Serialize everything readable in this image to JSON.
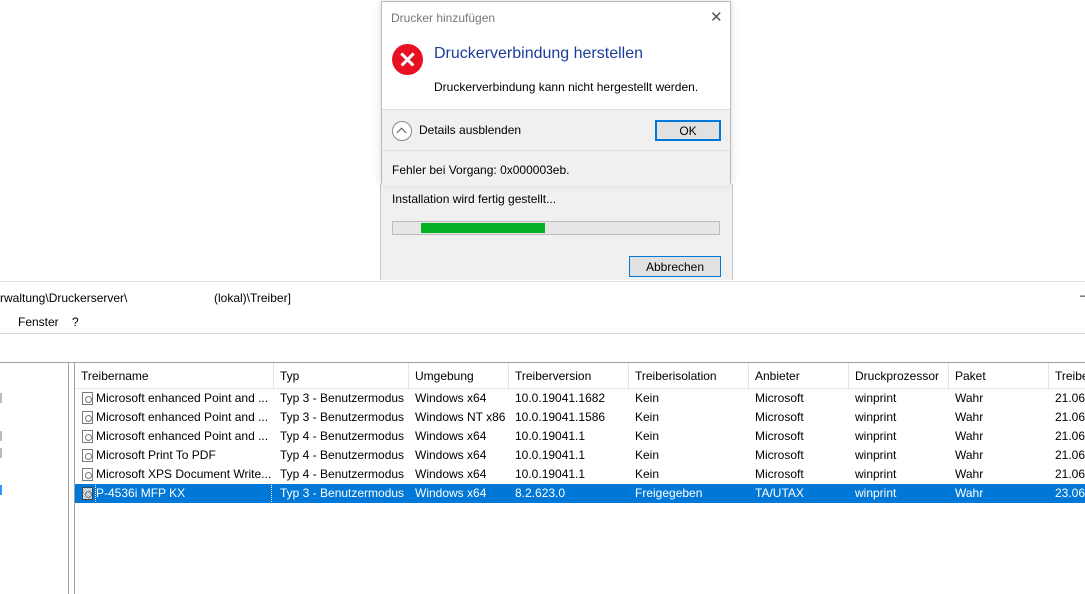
{
  "console": {
    "path_left": "rwaltung\\Druckerserver\\",
    "path_right": "(lokal)\\Treiber]",
    "minimize_glyph": "–",
    "menu": [
      "Fenster",
      "?"
    ]
  },
  "driver_table": {
    "columns": [
      "Treibername",
      "Typ",
      "Umgebung",
      "Treiberversion",
      "Treiberisolation",
      "Anbieter",
      "Druckprozessor",
      "Paket",
      "Treibe"
    ],
    "rows": [
      [
        "Microsoft enhanced Point and ...",
        "Typ 3 - Benutzermodus",
        "Windows x64",
        "10.0.19041.1682",
        "Kein",
        "Microsoft",
        "winprint",
        "Wahr",
        "21.06."
      ],
      [
        "Microsoft enhanced Point and ...",
        "Typ 3 - Benutzermodus",
        "Windows NT x86",
        "10.0.19041.1586",
        "Kein",
        "Microsoft",
        "winprint",
        "Wahr",
        "21.06."
      ],
      [
        "Microsoft enhanced Point and ...",
        "Typ 4 - Benutzermodus",
        "Windows x64",
        "10.0.19041.1",
        "Kein",
        "Microsoft",
        "winprint",
        "Wahr",
        "21.06."
      ],
      [
        "Microsoft Print To PDF",
        "Typ 4 - Benutzermodus",
        "Windows x64",
        "10.0.19041.1",
        "Kein",
        "Microsoft",
        "winprint",
        "Wahr",
        "21.06."
      ],
      [
        "Microsoft XPS Document Write...",
        "Typ 4 - Benutzermodus",
        "Windows x64",
        "10.0.19041.1",
        "Kein",
        "Microsoft",
        "winprint",
        "Wahr",
        "21.06."
      ],
      [
        "P-4536i MFP KX",
        "Typ 3 - Benutzermodus",
        "Windows x64",
        "8.2.623.0",
        "Freigegeben",
        "TA/UTAX",
        "winprint",
        "Wahr",
        "23.06."
      ]
    ],
    "selected_row": 5,
    "icon": "printer-driver-icon"
  },
  "progress_window": {
    "status": "Installation wird fertig gestellt...",
    "progress_fraction": 0.38,
    "cancel_label": "Abbrechen",
    "bar_color": "#06b025"
  },
  "error_dialog": {
    "title": "Drucker hinzufügen",
    "close_glyph": "✕",
    "heading": "Druckerverbindung herstellen",
    "message": "Druckerverbindung kann nicht hergestellt werden.",
    "details_label": "Details ausblenden",
    "ok_label": "OK",
    "error_code": "Fehler bei Vorgang: 0x000003eb.",
    "icon": "error-icon",
    "heading_color": "#1c3d9a",
    "icon_color": "#e81123"
  }
}
